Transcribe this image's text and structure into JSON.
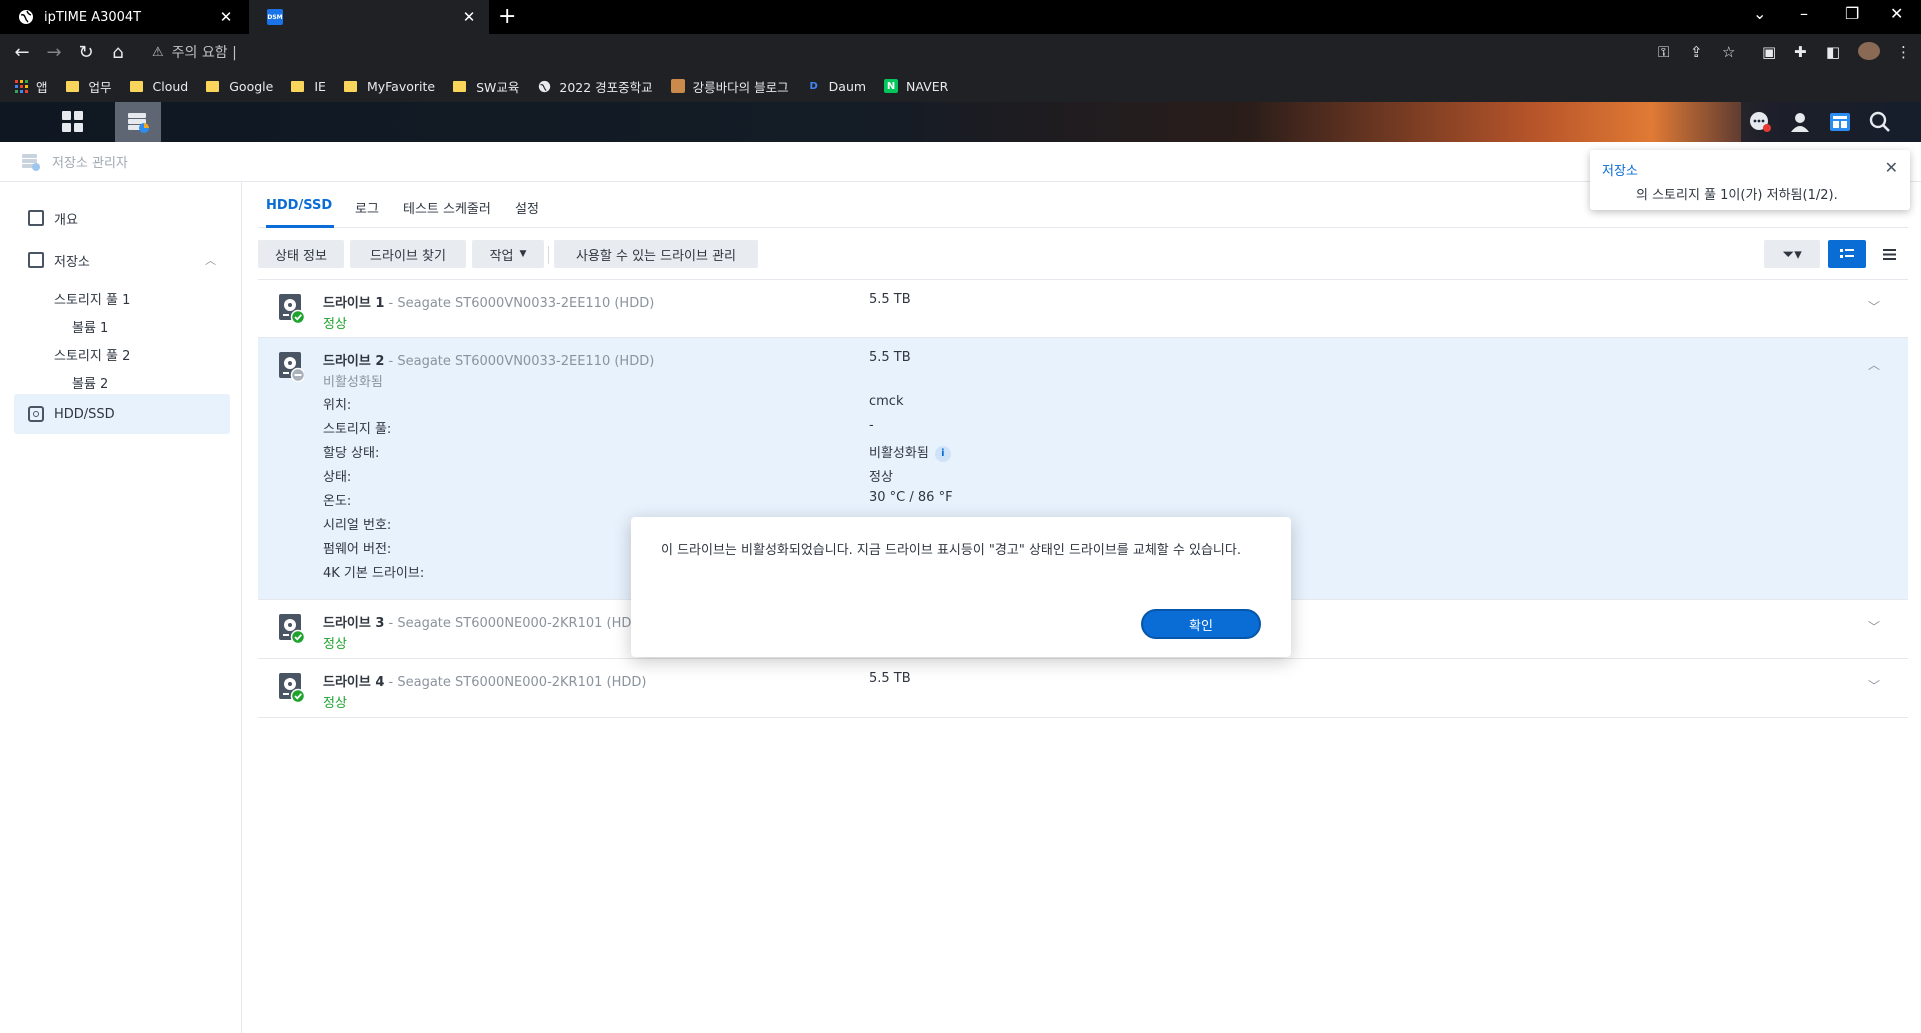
{
  "browser": {
    "tabs": [
      {
        "title": "ipTIME A3004T",
        "favicon": "globe-icon"
      },
      {
        "title": "",
        "favicon": "dsm-icon",
        "favicon_text": "DSM"
      }
    ],
    "address": "주의 요함  |",
    "bookmarks": [
      {
        "label": "앱",
        "icon": "apps-grid-icon"
      },
      {
        "label": "업무",
        "icon": "folder-icon"
      },
      {
        "label": "Cloud",
        "icon": "folder-icon"
      },
      {
        "label": "Google",
        "icon": "folder-icon"
      },
      {
        "label": "IE",
        "icon": "folder-icon"
      },
      {
        "label": "MyFavorite",
        "icon": "folder-icon"
      },
      {
        "label": "SW교육",
        "icon": "folder-icon"
      },
      {
        "label": "2022 경포중학교",
        "icon": "globe-icon"
      },
      {
        "label": "강릉바다의 블로그",
        "icon": "blog-icon"
      },
      {
        "label": "Daum",
        "icon": "daum-icon"
      },
      {
        "label": "NAVER",
        "icon": "naver-icon"
      }
    ]
  },
  "app": {
    "title": "저장소 관리자"
  },
  "sidebar": {
    "overview": "개요",
    "storage": "저장소",
    "pool1": "스토리지 풀 1",
    "volume1": "볼륨 1",
    "pool2": "스토리지 풀 2",
    "volume2": "볼륨 2",
    "hddssd": "HDD/SSD"
  },
  "tabs": [
    "HDD/SSD",
    "로그",
    "테스트 스케줄러",
    "설정"
  ],
  "actions": {
    "status_info": "상태 정보",
    "find_drive": "드라이브 찾기",
    "task": "작업",
    "manage_available": "사용할 수 있는 드라이브 관리"
  },
  "drives": [
    {
      "label": "드라이브 1",
      "model": " - Seagate ST6000VN0033-2EE110 (HDD)",
      "status": "정상",
      "size": "5.5 TB"
    },
    {
      "label": "드라이브 2",
      "model": " - Seagate ST6000VN0033-2EE110 (HDD)",
      "status": "비활성화됨",
      "size": "5.5 TB"
    },
    {
      "label": "드라이브 3",
      "model": " - Seagate ST6000NE000-2KR101 (HD",
      "status": "정상",
      "size": ""
    },
    {
      "label": "드라이브 4",
      "model": " - Seagate ST6000NE000-2KR101 (HDD)",
      "status": "정상",
      "size": "5.5 TB"
    }
  ],
  "details": {
    "location_label": "위치:",
    "location_value": "cmck",
    "pool_label": "스토리지 풀:",
    "pool_value": "-",
    "alloc_label": "할당 상태:",
    "alloc_value": "비활성화됨",
    "state_label": "상태:",
    "state_value": "정상",
    "temp_label": "온도:",
    "temp_value": "30 °C / 86 °F",
    "serial_label": "시리얼 번호:",
    "firmware_label": "펌웨어 버전:",
    "native4k_label": "4K 기본 드라이브:"
  },
  "notification": {
    "title": "저장소",
    "text": "의 스토리지 풀 1이(가) 저하됨(1/2)."
  },
  "dialog": {
    "message": "이 드라이브는 비활성화되었습니다. 지금 드라이브 표시등이 \"경고\" 상태인 드라이브를 교체할 수 있습니다.",
    "ok": "확인"
  },
  "colors": {
    "accent": "#0a6cd5",
    "ok": "#1fa32f",
    "expanded_row": "#e8f2fd"
  }
}
